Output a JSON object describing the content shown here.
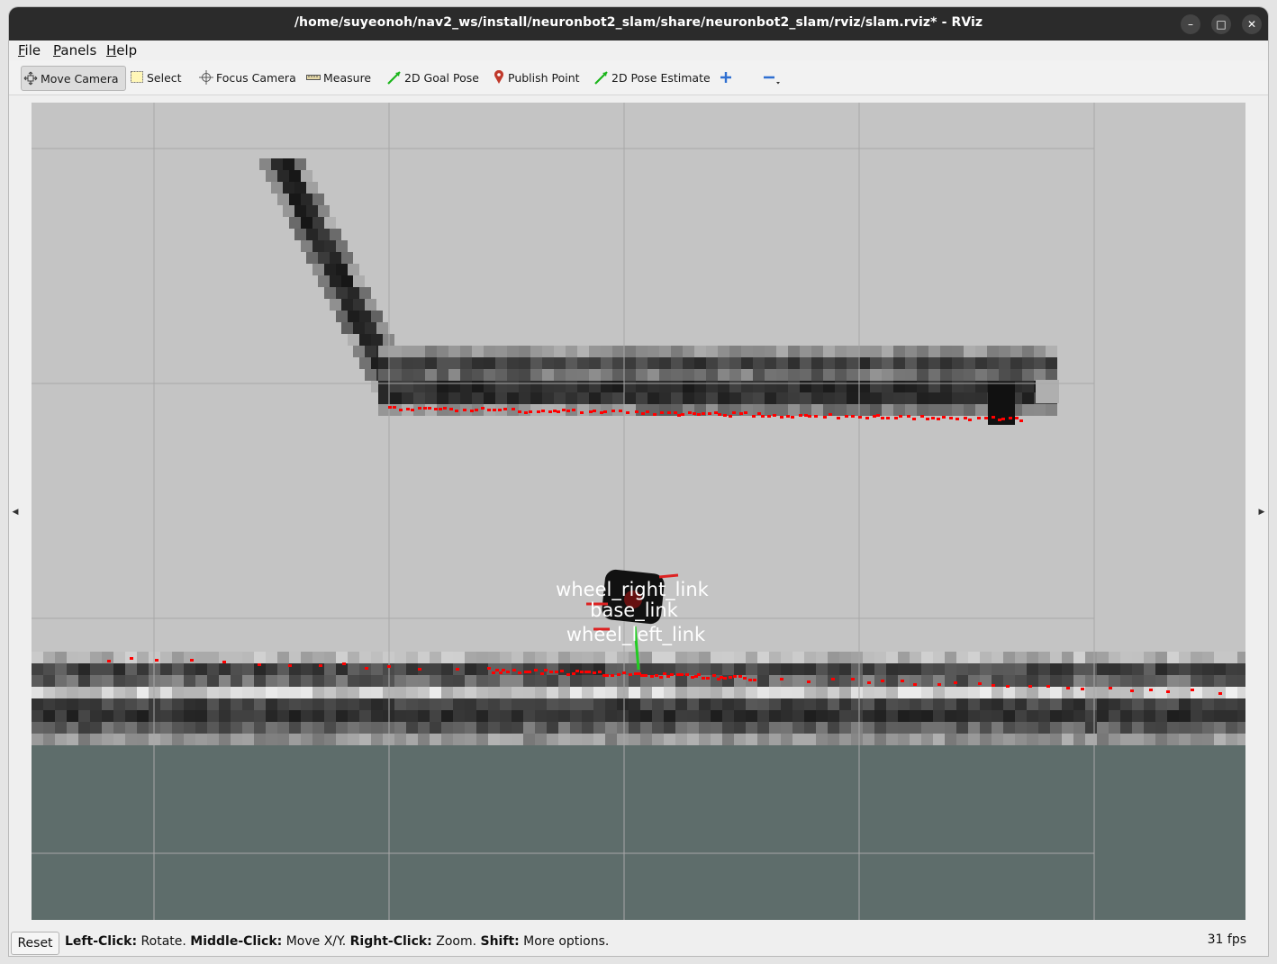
{
  "window": {
    "title": "/home/suyeonoh/nav2_ws/install/neuronbot2_slam/share/neuronbot2_slam/rviz/slam.rviz* - RViz",
    "controls": {
      "minimize": "–",
      "maximize": "□",
      "close": "✕"
    }
  },
  "menu": [
    {
      "accel": "F",
      "rest": "ile"
    },
    {
      "accel": "P",
      "rest": "anels"
    },
    {
      "accel": "H",
      "rest": "elp"
    }
  ],
  "toolbar": {
    "move_camera": "Move Camera",
    "select": "Select",
    "focus_camera": "Focus Camera",
    "measure": "Measure",
    "goal_pose": "2D Goal Pose",
    "publish_point": "Publish Point",
    "pose_estimate": "2D Pose Estimate",
    "add_icon": "plus-icon",
    "remove_icon": "minus-icon"
  },
  "scene": {
    "frame_labels": {
      "right": "wheel_right_link",
      "base": "base_link",
      "left": "wheel_left_link"
    },
    "colors": {
      "background": "#c4c4c4",
      "unknown_area": "#5e6d6b",
      "laser": "#ff0000",
      "axis_green": "#22cc22",
      "axis_red": "#dd2222"
    }
  },
  "status": {
    "reset": "Reset",
    "hint": [
      {
        "bold": "Left-Click:",
        "text": " Rotate. "
      },
      {
        "bold": "Middle-Click:",
        "text": " Move X/Y. "
      },
      {
        "bold": "Right-Click:",
        "text": " Zoom. "
      },
      {
        "bold": "Shift:",
        "text": " More options."
      }
    ],
    "fps": "31 fps"
  }
}
